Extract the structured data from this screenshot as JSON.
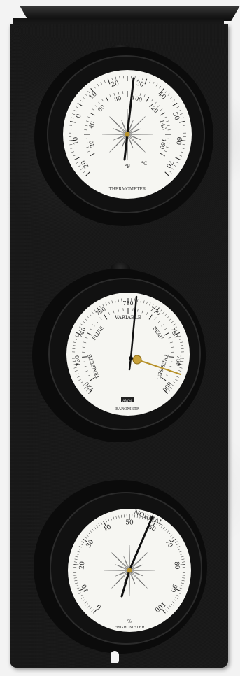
{
  "thermometer": {
    "name": "THERMOMETER",
    "fahrenheit_labels": [
      "20",
      "40",
      "60",
      "80",
      "100",
      "120",
      "140",
      "160"
    ],
    "celsius_labels": [
      "20",
      "10",
      "0",
      "10",
      "20",
      "30",
      "40",
      "50",
      "60",
      "70"
    ],
    "unit_f": "°F",
    "unit_c": "°C"
  },
  "barometer": {
    "name": "BAROMETR",
    "scale_labels": [
      "720",
      "730",
      "740",
      "750",
      "760",
      "770",
      "780",
      "790",
      "800"
    ],
    "weather_words": [
      "TEMPETE",
      "PLUIE",
      "VARIABLE",
      "BEAU",
      "TRES SEC"
    ],
    "brand_mark": "AWM"
  },
  "hygrometer": {
    "name": "HYGROMETER",
    "unit": "%",
    "scale_labels": [
      "0",
      "10",
      "20",
      "30",
      "40",
      "50",
      "60",
      "70",
      "80",
      "90",
      "100"
    ],
    "zone_label": "NORMAL"
  },
  "colors": {
    "board": "#181818",
    "dial_face": "#f6f6f2",
    "ink": "#222222",
    "bezel": "#0d0d0d"
  }
}
